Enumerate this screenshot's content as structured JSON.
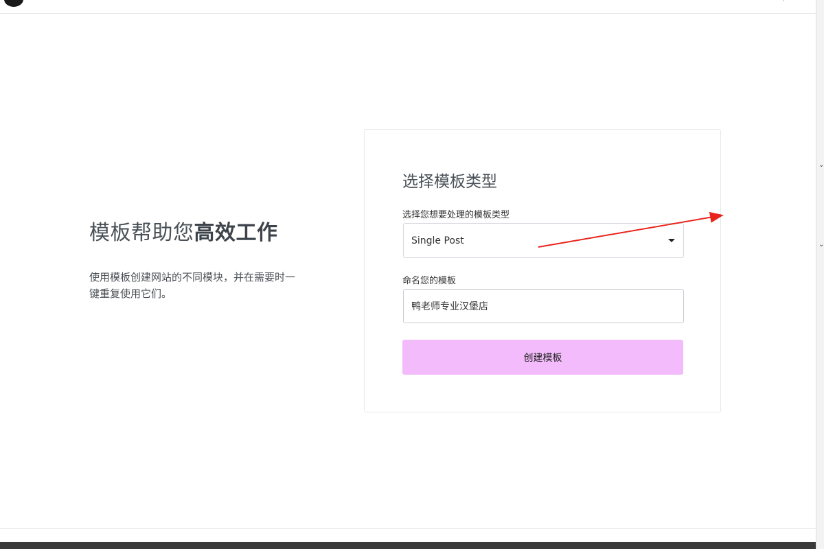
{
  "intro": {
    "title_regular": "模板帮助您",
    "title_bold": "高效工作",
    "description": "使用模板创建网站的不同模块，并在需要时一键重复使用它们。"
  },
  "form": {
    "title": "选择模板类型",
    "type_label": "选择您想要处理的模板类型",
    "type_selected": "Single Post",
    "name_label": "命名您的模板",
    "name_value": "鸭老师专业汉堡店",
    "submit_label": "创建模板"
  },
  "colors": {
    "button_bg": "#f3bbfb",
    "annotation_arrow": "#e8231c"
  },
  "icons": {
    "select_caret": "caret-down-icon",
    "annotation": "arrow-annotation-icon"
  }
}
